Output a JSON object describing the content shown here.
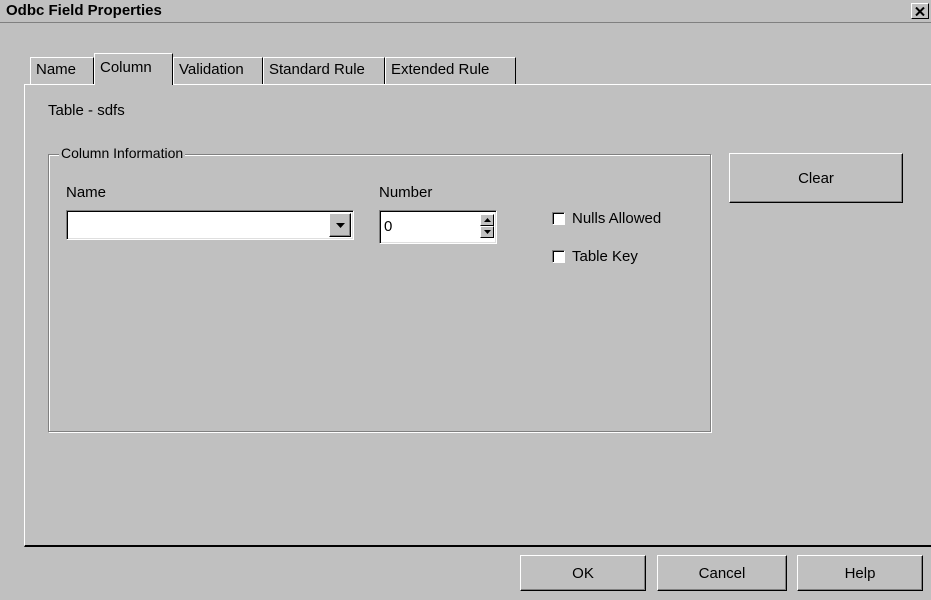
{
  "window": {
    "title": "Odbc Field Properties"
  },
  "tabs": [
    {
      "label": "Name"
    },
    {
      "label": "Column"
    },
    {
      "label": "Validation"
    },
    {
      "label": "Standard Rule"
    },
    {
      "label": "Extended Rule"
    }
  ],
  "table_label": "Table - sdfs",
  "column_info": {
    "group_label": "Column Information",
    "name_label": "Name",
    "name_value": "",
    "number_label": "Number",
    "number_value": "0",
    "nulls_allowed_label": "Nulls Allowed",
    "nulls_allowed_checked": false,
    "table_key_label": "Table Key",
    "table_key_checked": false
  },
  "buttons": {
    "clear": "Clear",
    "ok": "OK",
    "cancel": "Cancel",
    "help": "Help"
  },
  "icons": {
    "close": "close-icon",
    "dropdown": "chevron-down-icon",
    "spin_up": "spin-up-icon",
    "spin_down": "spin-down-icon"
  }
}
